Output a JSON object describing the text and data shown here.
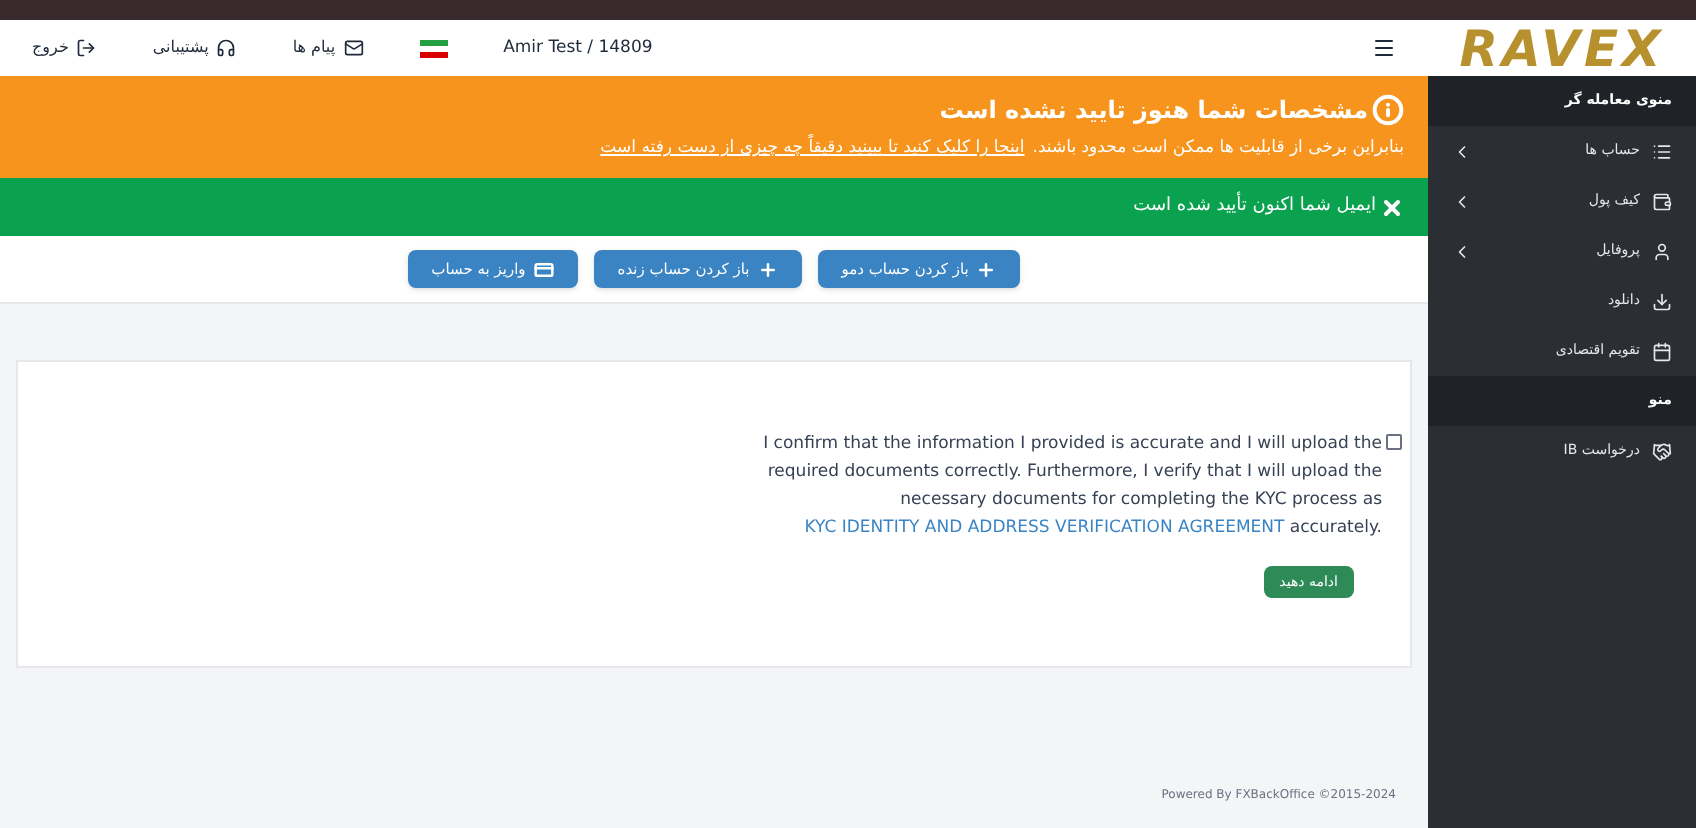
{
  "header": {
    "user": "Amir Test / 14809",
    "links": [
      "پیام ها",
      "پشتیبانی",
      "خروج"
    ]
  },
  "logo": "RAVEX",
  "alerts": [
    {
      "kind": "warning",
      "title": "مشخصات شما هنوز تایید نشده است",
      "text": "بنابراین برخی از قابلیت ها ممکن است محدود باشند.",
      "link": "اینجا را کلیک کنید تا ببینید دقیقاً چه چیزی از دست رفته است"
    },
    {
      "kind": "success",
      "title": "ایمیل شما اکنون تأیید شده است"
    }
  ],
  "actions": [
    "باز کردن حساب دمو",
    "باز کردن حساب زنده",
    "واریز به حساب"
  ],
  "agreement": {
    "checked": false,
    "text_before": "I confirm that the information I provided is accurate and I will upload the required documents correctly. Furthermore, I verify that I will upload the necessary documents for completing the KYC process as",
    "link": "KYC IDENTITY AND ADDRESS VERIFICATION AGREEMENT",
    "text_after": "accurately.",
    "button": "ادامه دهید"
  },
  "footer": "Powered By FXBackOffice ©2015-2024",
  "sidebar": {
    "sections": [
      {
        "title": "منوی معامله گر",
        "items": [
          {
            "label": "حساب ها",
            "expandable": true
          },
          {
            "label": "کیف پول",
            "expandable": true
          },
          {
            "label": "پروفایل",
            "expandable": true
          },
          {
            "label": "دانلود",
            "expandable": false
          },
          {
            "label": "تقویم اقتصادی",
            "expandable": false
          }
        ]
      },
      {
        "title": "منو",
        "items": [
          {
            "label": "درخواست IB",
            "expandable": false
          }
        ]
      }
    ]
  }
}
